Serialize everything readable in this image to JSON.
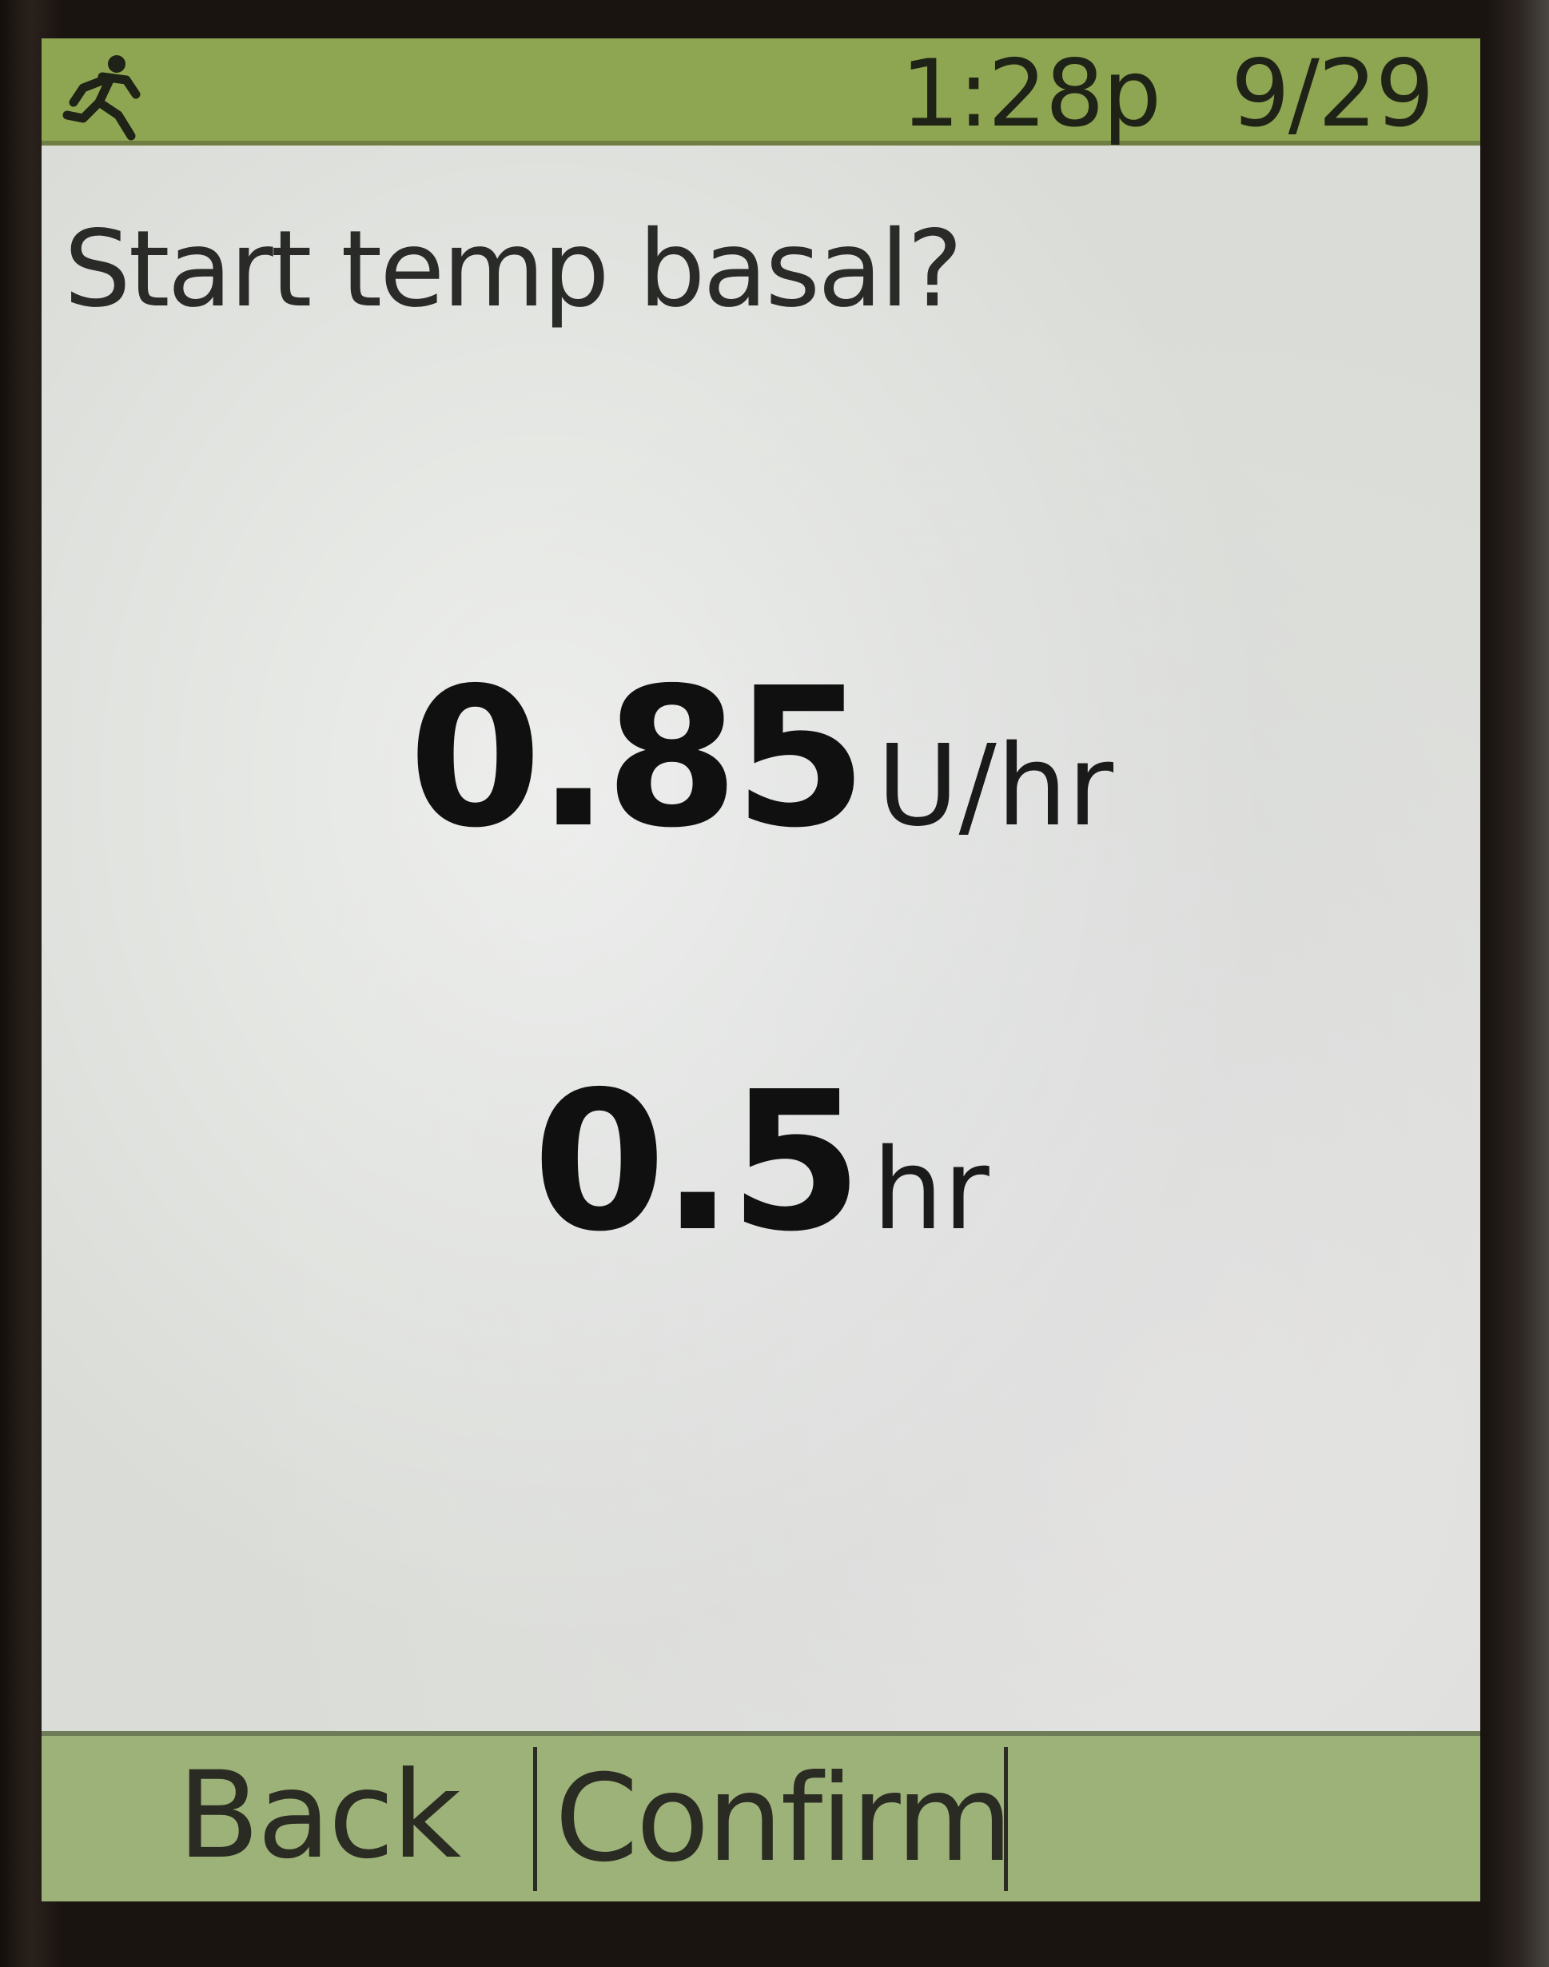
{
  "status_bar": {
    "activity_icon": "running-person-icon",
    "time": "1:28p",
    "date": "9/29",
    "bar_color": "#8ea651"
  },
  "screen": {
    "title": "Start temp basal?",
    "rate": {
      "value": "0.85",
      "unit": "U/hr"
    },
    "duration": {
      "value": "0.5",
      "unit": "hr"
    }
  },
  "softkeys": {
    "back_label": "Back",
    "confirm_label": "Confirm",
    "bar_color": "#9db278"
  }
}
